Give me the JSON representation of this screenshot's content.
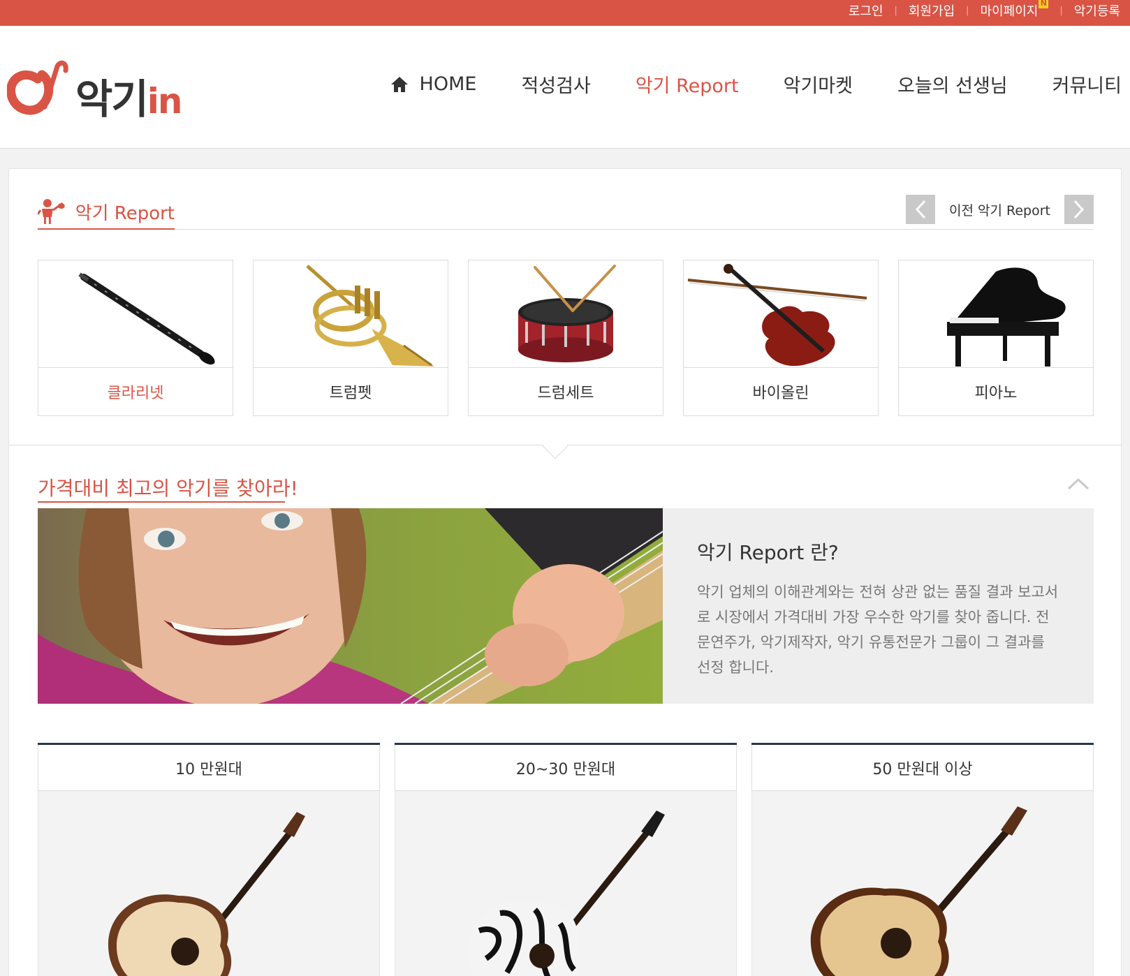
{
  "topbar": {
    "login": "로그인",
    "signup": "회원가입",
    "mypage": "마이페이지",
    "new_badge": "N",
    "register": "악기등록",
    "separator": "|",
    "color": "#d95445"
  },
  "logo": {
    "text": "악기",
    "suffix": "in"
  },
  "nav": {
    "items": [
      {
        "label": "HOME",
        "icon": "home-icon"
      },
      {
        "label": "적성검사"
      },
      {
        "label": "악기 Report",
        "active": true
      },
      {
        "label": "악기마켓"
      },
      {
        "label": "오늘의 선생님"
      },
      {
        "label": "커뮤니티"
      }
    ]
  },
  "report": {
    "title": "악기 Report",
    "icon": "kid-violin-icon",
    "pager_label": "이전 악기 Report",
    "instruments": [
      {
        "label": "클라리넷",
        "icon": "clarinet-image",
        "selected": true
      },
      {
        "label": "트럼펫",
        "icon": "trumpet-image"
      },
      {
        "label": "드럼세트",
        "icon": "drum-image"
      },
      {
        "label": "바이올린",
        "icon": "violin-image"
      },
      {
        "label": "피아노",
        "icon": "piano-image"
      }
    ]
  },
  "promo": {
    "title": "가격대비 최고의 악기를 찾아라!",
    "about_title": "악기 Report 란?",
    "about_body": "악기 업체의 이해관계와는 전혀 상관 없는 품질 결과 보고서로 시장에서 가격대비 가장 우수한 악기를 찾아 줍니다. 전문연주가, 악기제작자, 악기 유통전문가 그룹이 그 결과를 선정 합니다."
  },
  "prices": [
    {
      "label": "10 만원대"
    },
    {
      "label": "20~30 만원대"
    },
    {
      "label": "50 만원대 이상"
    }
  ],
  "colors": {
    "accent": "#d95445",
    "dark_border": "#27364a",
    "text": "#333333",
    "muted": "#777777"
  }
}
